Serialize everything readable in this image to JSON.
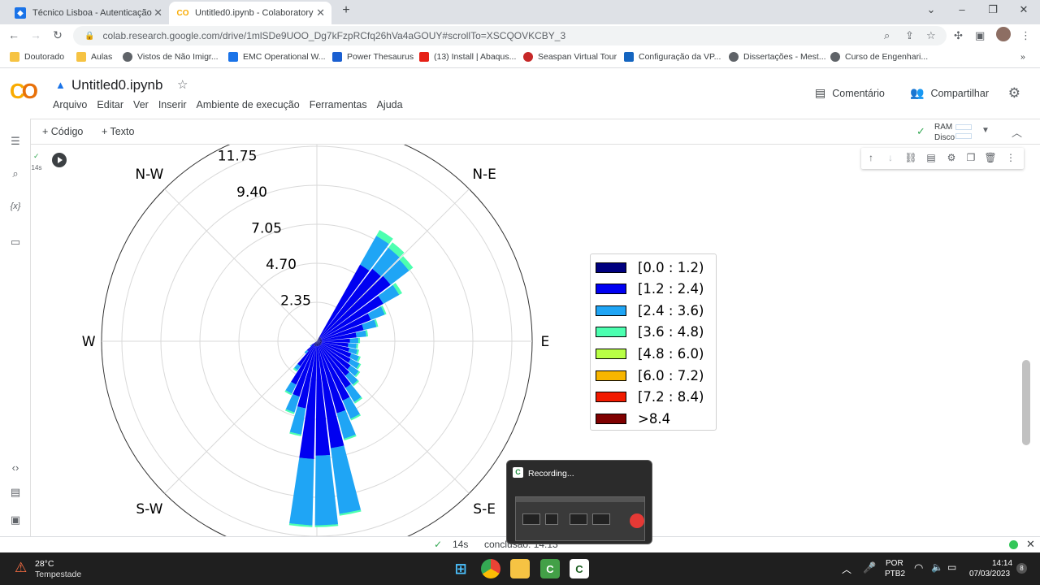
{
  "tabs": [
    {
      "label": "Técnico Lisboa - Autenticação",
      "favicon": "shield-icon",
      "active": false
    },
    {
      "label": "Untitled0.ipynb - Colaboratory",
      "favicon": "colab-icon",
      "active": true
    }
  ],
  "address": {
    "url": "colab.research.google.com/drive/1mlSDe9UOO_Dg7kFzpRCfq26hVa4aGOUY#scrollTo=XSCQOVKCBY_3"
  },
  "bookmarks": [
    {
      "label": "Doutorado",
      "color": "#f6c343"
    },
    {
      "label": "Aulas",
      "color": "#f6c343"
    },
    {
      "label": "Vistos de Não Imigr...",
      "color": "#5f6368"
    },
    {
      "label": "EMC Operational W...",
      "color": "#1a73e8"
    },
    {
      "label": "Power Thesaurus",
      "color": "#1a5fd1"
    },
    {
      "label": "(13) Install | Abaqus...",
      "color": "#e62117"
    },
    {
      "label": "Seaspan Virtual Tour",
      "color": "#c62828"
    },
    {
      "label": "Configuração da VP...",
      "color": "#1565c0"
    },
    {
      "label": "Dissertações - Mest...",
      "color": "#5f6368"
    },
    {
      "label": "Curso de Engenhari...",
      "color": "#5f6368"
    }
  ],
  "colab": {
    "title": "Untitled0.ipynb",
    "menu": [
      "Arquivo",
      "Editar",
      "Ver",
      "Inserir",
      "Ambiente de execução",
      "Ferramentas",
      "Ajuda"
    ],
    "comment_label": "Comentário",
    "share_label": "Compartilhar",
    "add_code": "+ Código",
    "add_text": "+ Texto",
    "ram_label": "RAM",
    "disk_label": "Disco",
    "cell_time": "14s"
  },
  "chart_data": {
    "type": "windrose",
    "directions": [
      "N-W",
      "N-E",
      "W",
      "E",
      "S-W",
      "S-E"
    ],
    "radial_ticks": [
      2.35,
      4.7,
      7.05,
      9.4,
      11.75
    ],
    "radial_tick_labels": [
      "2.35",
      "4.70",
      "7.05",
      "9.40",
      "11.75"
    ],
    "legend": [
      {
        "label": "[0.0 : 1.2)",
        "color": "#00007f"
      },
      {
        "label": "[1.2 : 2.4)",
        "color": "#0000f1"
      },
      {
        "label": "[2.4 : 3.6)",
        "color": "#1fa5f5"
      },
      {
        "label": "[3.6 : 4.8)",
        "color": "#4cffb0"
      },
      {
        "label": "[4.8 : 6.0)",
        "color": "#b8ff45"
      },
      {
        "label": "[6.0 : 7.2)",
        "color": "#f7b500"
      },
      {
        "label": "[7.2 : 8.4)",
        "color": "#f11a00"
      },
      {
        "label": ">8.4",
        "color": "#7f0000"
      }
    ],
    "sectors": [
      {
        "angle_deg": 33,
        "bins": [
          0.3,
          5.0,
          2.0,
          0.4
        ]
      },
      {
        "angle_deg": 41,
        "bins": [
          0.3,
          5.2,
          1.6,
          0.4
        ]
      },
      {
        "angle_deg": 49,
        "bins": [
          0.3,
          5.3,
          1.4,
          0.3
        ]
      },
      {
        "angle_deg": 57,
        "bins": [
          0.3,
          4.3,
          1.1,
          0.2
        ]
      },
      {
        "angle_deg": 65,
        "bins": [
          0.3,
          3.2,
          0.9,
          0.1
        ]
      },
      {
        "angle_deg": 73,
        "bins": [
          0.3,
          2.6,
          0.8,
          0.1
        ]
      },
      {
        "angle_deg": 81,
        "bins": [
          0.3,
          2.1,
          0.6,
          0.1
        ]
      },
      {
        "angle_deg": 89,
        "bins": [
          0.3,
          1.7,
          0.5,
          0.1
        ]
      },
      {
        "angle_deg": 97,
        "bins": [
          0.3,
          1.6,
          0.5,
          0.1
        ]
      },
      {
        "angle_deg": 105,
        "bins": [
          0.3,
          1.7,
          0.5,
          0.1
        ]
      },
      {
        "angle_deg": 113,
        "bins": [
          0.3,
          1.9,
          0.5,
          0.1
        ]
      },
      {
        "angle_deg": 121,
        "bins": [
          0.3,
          2.0,
          0.6,
          0.1
        ]
      },
      {
        "angle_deg": 129,
        "bins": [
          0.3,
          2.2,
          0.6,
          0.1
        ]
      },
      {
        "angle_deg": 137,
        "bins": [
          0.3,
          2.4,
          0.7,
          0.1
        ]
      },
      {
        "angle_deg": 145,
        "bins": [
          0.3,
          3.0,
          1.0,
          0.1
        ]
      },
      {
        "angle_deg": 153,
        "bins": [
          0.3,
          3.6,
          1.2,
          0.1
        ]
      },
      {
        "angle_deg": 161,
        "bins": [
          0.3,
          4.2,
          1.6,
          0.1
        ]
      },
      {
        "angle_deg": 169,
        "bins": [
          0.3,
          6.2,
          4.0,
          0.1
        ]
      },
      {
        "angle_deg": 177,
        "bins": [
          0.3,
          6.6,
          4.2,
          0.1
        ]
      },
      {
        "angle_deg": 185,
        "bins": [
          0.3,
          6.8,
          4.0,
          0.1
        ]
      },
      {
        "angle_deg": 193,
        "bins": [
          0.3,
          3.8,
          1.6,
          0.1
        ]
      },
      {
        "angle_deg": 201,
        "bins": [
          0.3,
          3.2,
          1.0,
          0.1
        ]
      },
      {
        "angle_deg": 209,
        "bins": [
          0.3,
          2.6,
          0.6,
          0.1
        ]
      },
      {
        "angle_deg": 217,
        "bins": [
          0.3,
          1.5,
          0.3,
          0.1
        ]
      },
      {
        "angle_deg": 225,
        "bins": [
          0.2,
          0.6,
          0.2,
          0.0
        ]
      },
      {
        "angle_deg": 233,
        "bins": [
          0.1,
          0.3,
          0.1,
          0.0
        ]
      }
    ]
  },
  "status": {
    "time": "14s",
    "text": "conclusão: 14:13"
  },
  "recording": {
    "title": "Recording..."
  },
  "taskbar": {
    "temp": "28°C",
    "weather": "Tempestade",
    "lang1": "POR",
    "lang2": "PTB2",
    "time": "14:14",
    "date": "07/03/2023",
    "notif_count": "8"
  }
}
